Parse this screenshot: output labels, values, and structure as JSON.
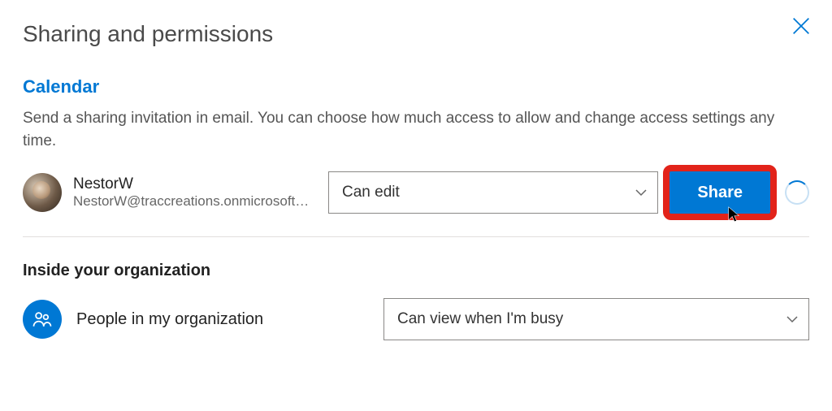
{
  "title": "Sharing and permissions",
  "section_link": "Calendar",
  "description": "Send a sharing invitation in email. You can choose how much access to allow and change access settings any time.",
  "invite": {
    "person": {
      "name": "NestorW",
      "email": "NestorW@traccreations.onmicrosoft…"
    },
    "permission_selected": "Can edit",
    "share_button_label": "Share"
  },
  "org_section": {
    "heading": "Inside your organization",
    "label": "People in my organization",
    "permission_selected": "Can view when I'm busy"
  },
  "colors": {
    "accent": "#0078d4",
    "highlight": "#e2231a"
  }
}
